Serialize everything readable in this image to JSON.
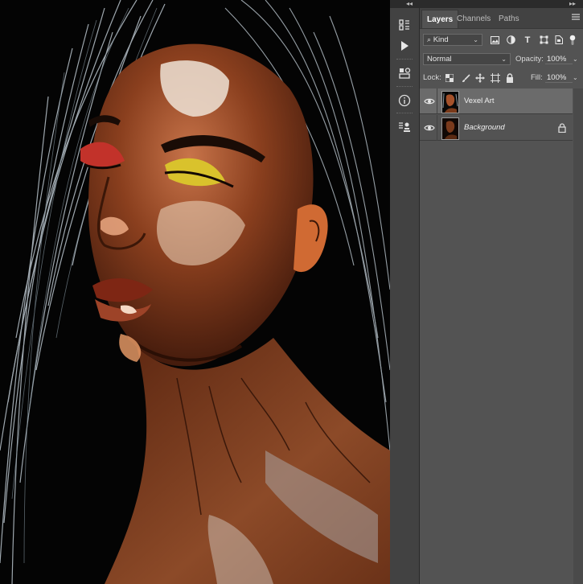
{
  "panel": {
    "tabs": [
      {
        "label": "Layers",
        "active": true
      },
      {
        "label": "Channels",
        "active": false
      },
      {
        "label": "Paths",
        "active": false
      }
    ]
  },
  "filter": {
    "kind_label": "Kind",
    "icons": [
      "image-filter-icon",
      "adjustment-filter-icon",
      "type-filter-icon",
      "shape-filter-icon",
      "smart-object-filter-icon",
      "filter-toggle-icon"
    ]
  },
  "blend": {
    "mode": "Normal",
    "opacity_label": "Opacity:",
    "opacity_value": "100%"
  },
  "lock": {
    "label": "Lock:",
    "fill_label": "Fill:",
    "fill_value": "100%"
  },
  "layers": [
    {
      "name": "Vexel Art",
      "visible": true,
      "selected": true,
      "italic": false,
      "locked": false
    },
    {
      "name": "Background",
      "visible": true,
      "selected": false,
      "italic": true,
      "locked": true
    }
  ],
  "dock": {
    "icons": [
      "history-icon",
      "play-actions-icon",
      "properties-icon",
      "info-icon",
      "clone-source-icon"
    ]
  },
  "colors": {
    "panel_bg": "#535353",
    "tab_bar": "#424242",
    "selected_row": "#6b6b6b"
  }
}
